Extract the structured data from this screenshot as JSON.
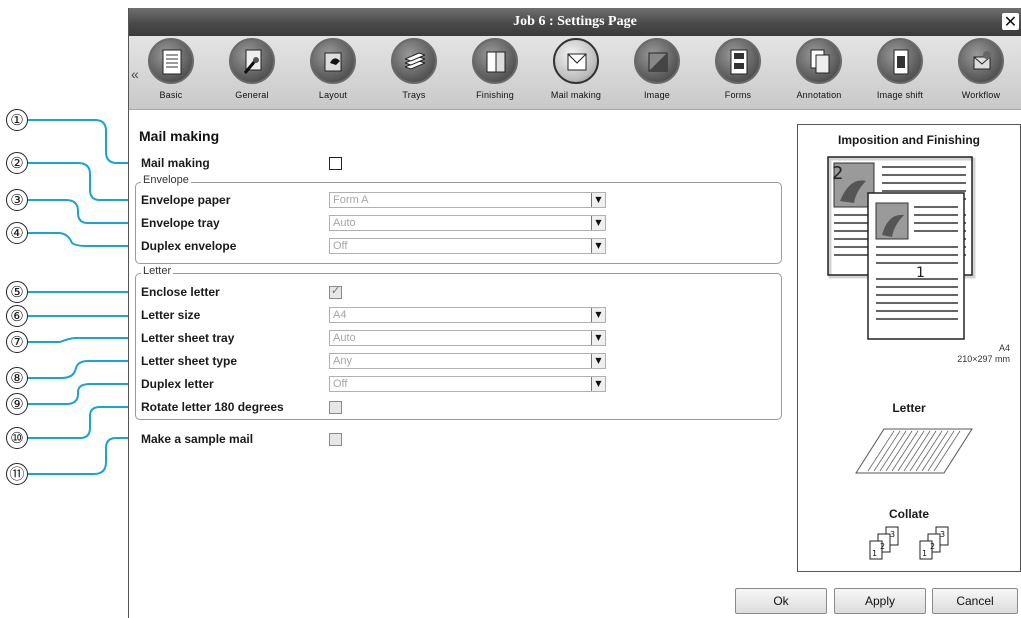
{
  "window": {
    "title": "Job 6 : Settings Page",
    "close_glyph": "✕"
  },
  "toolbar": {
    "scroll_left": "«",
    "tabs": [
      {
        "label": "Basic"
      },
      {
        "label": "General"
      },
      {
        "label": "Layout"
      },
      {
        "label": "Trays"
      },
      {
        "label": "Finishing"
      },
      {
        "label": "Mail making"
      },
      {
        "label": "Image"
      },
      {
        "label": "Forms"
      },
      {
        "label": "Annotation"
      },
      {
        "label": "Image shift"
      },
      {
        "label": "Workflow"
      }
    ],
    "active_tab": "Mail making"
  },
  "callouts": [
    "①",
    "②",
    "③",
    "④",
    "⑤",
    "⑥",
    "⑦",
    "⑧",
    "⑨",
    "⑩",
    "⑪"
  ],
  "section": {
    "heading": "Mail making",
    "mail_making": {
      "label": "Mail making",
      "checked": false
    },
    "envelope": {
      "legend": "Envelope",
      "paper": {
        "label": "Envelope paper",
        "value": "Form A"
      },
      "tray": {
        "label": "Envelope tray",
        "value": "Auto"
      },
      "duplex": {
        "label": "Duplex envelope",
        "value": "Off"
      }
    },
    "letter": {
      "legend": "Letter",
      "enclose": {
        "label": "Enclose letter",
        "checked": true,
        "tick": "✓"
      },
      "size": {
        "label": "Letter size",
        "value": "A4"
      },
      "tray": {
        "label": "Letter sheet tray",
        "value": "Auto"
      },
      "type": {
        "label": "Letter sheet type",
        "value": "Any"
      },
      "duplex": {
        "label": "Duplex letter",
        "value": "Off"
      },
      "rotate": {
        "label": "Rotate letter 180 degrees",
        "checked": false
      }
    },
    "sample": {
      "label": "Make a sample mail",
      "checked": false
    }
  },
  "preview": {
    "title": "Imposition and Finishing",
    "page_numbers": [
      "2",
      "1"
    ],
    "paper_size": "A4",
    "paper_dims": "210×297 mm",
    "letter_title": "Letter",
    "collate_title": "Collate",
    "collate_pages": [
      "1",
      "2",
      "3"
    ]
  },
  "buttons": {
    "ok": "Ok",
    "apply": "Apply",
    "cancel": "Cancel"
  },
  "colors": {
    "leader": "#1aa3d9",
    "titlebar": "#4a4a4a",
    "accent": "#333333"
  },
  "icons": {
    "close": "close-icon",
    "scroll_left": "double-chevron-left-icon",
    "dropdown": "chevron-down-icon",
    "check": "checkmark-icon"
  }
}
